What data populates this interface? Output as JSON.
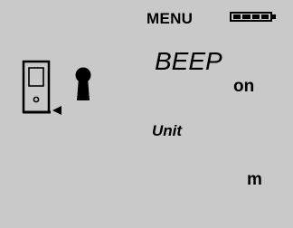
{
  "header": {
    "title": "MENU",
    "battery_icon": "battery-full-icon",
    "battery_level": 1.0
  },
  "icons": {
    "device": "laser-meter-device-icon",
    "lock": "keyhole-lock-icon"
  },
  "settings": {
    "beep": {
      "label": "BEEP",
      "value": "on"
    },
    "unit": {
      "label": "Unit",
      "value": "m"
    }
  },
  "colors": {
    "lcd_background": "#c9c9c9",
    "foreground": "#000000"
  }
}
